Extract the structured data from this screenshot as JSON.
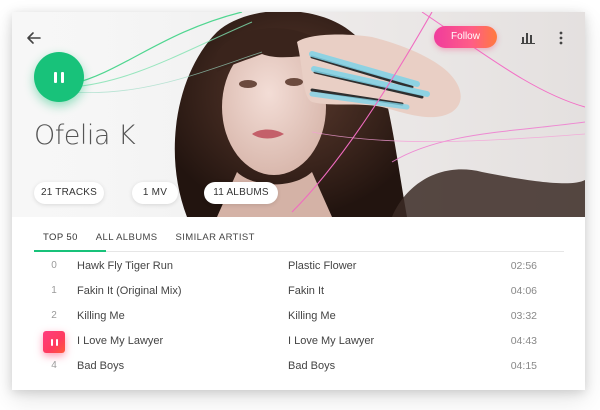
{
  "artist": {
    "name": "Ofelia K"
  },
  "header": {
    "follow_label": "Follow"
  },
  "stats": [
    {
      "label": "21 TRACKS"
    },
    {
      "label": "1 MV"
    },
    {
      "label": "11 ALBUMS"
    }
  ],
  "tabs": [
    {
      "label": "TOP 50",
      "active": true
    },
    {
      "label": "ALL ALBUMS",
      "active": false
    },
    {
      "label": "SIMILAR ARTIST",
      "active": false
    }
  ],
  "tracks": [
    {
      "num": "0",
      "title": "Hawk Fly Tiger Run",
      "album": "Plastic Flower",
      "duration": "02:56"
    },
    {
      "num": "1",
      "title": "Fakin It (Original Mix)",
      "album": "Fakin It",
      "duration": "04:06"
    },
    {
      "num": "2",
      "title": "Killing Me",
      "album": "Killing Me",
      "duration": "03:32"
    },
    {
      "num": "3",
      "title": "I Love My Lawyer",
      "album": "I Love My Lawyer",
      "duration": "04:43",
      "playing": true
    },
    {
      "num": "4",
      "title": "Bad Boys",
      "album": "Bad Boys",
      "duration": "04:15"
    }
  ],
  "colors": {
    "accent_green": "#18c27a",
    "follow_gradient_start": "#f03c9d",
    "follow_gradient_end": "#ff7a3e",
    "playing_red": "#ff3d6e"
  },
  "icons": {
    "back": "arrow-left-icon",
    "play_state": "pause-icon",
    "stats": "bar-chart-icon",
    "more": "more-vertical-icon"
  }
}
